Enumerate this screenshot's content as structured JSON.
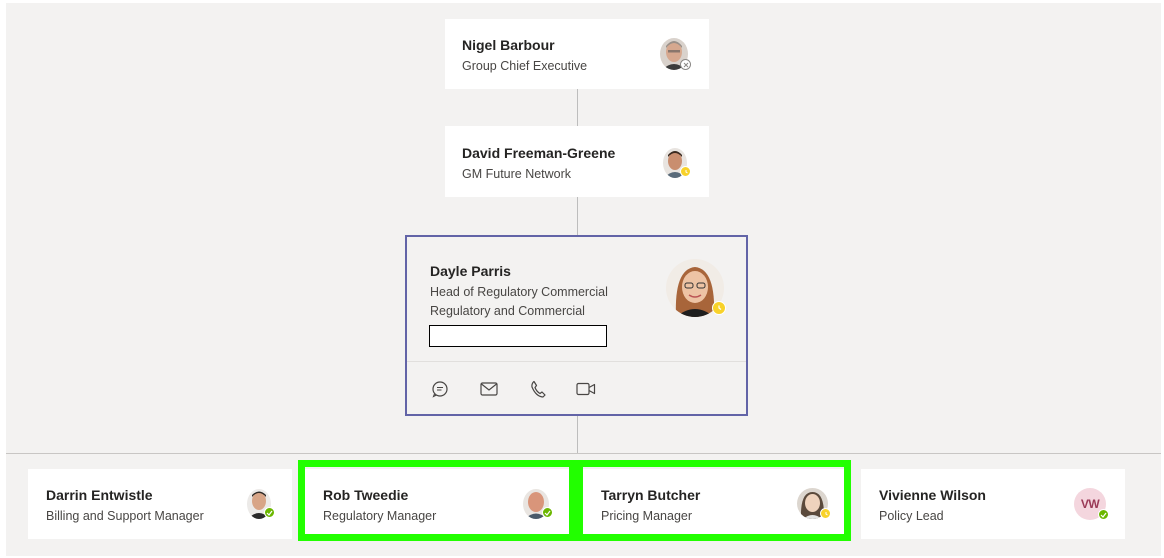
{
  "org_chart": {
    "manager_chain": [
      {
        "name": "Nigel Barbour",
        "title": "Group Chief Executive",
        "presence": "offline"
      },
      {
        "name": "David Freeman-Greene",
        "title": "GM Future Network",
        "presence": "away"
      }
    ],
    "focused": {
      "name": "Dayle Parris",
      "title": "Head of Regulatory Commercial",
      "department": "Regulatory and Commercial",
      "presence": "away",
      "actions": [
        "chat-icon",
        "mail-icon",
        "call-icon",
        "video-icon"
      ]
    },
    "reports": [
      {
        "name": "Darrin Entwistle",
        "title": "Billing and Support Manager",
        "presence": "available",
        "highlighted": false
      },
      {
        "name": "Rob Tweedie",
        "title": "Regulatory Manager",
        "presence": "available",
        "highlighted": true
      },
      {
        "name": "Tarryn Butcher",
        "title": "Pricing Manager",
        "presence": "away",
        "highlighted": true
      },
      {
        "name": "Vivienne Wilson",
        "title": "Policy Lead",
        "presence": "available",
        "highlighted": false,
        "initials": "VW"
      }
    ]
  },
  "colors": {
    "background": "#f3f2f1",
    "focus_border": "#6264a7",
    "highlight": "#22ff00",
    "available": "#6bb700",
    "away": "#f8d22a"
  }
}
